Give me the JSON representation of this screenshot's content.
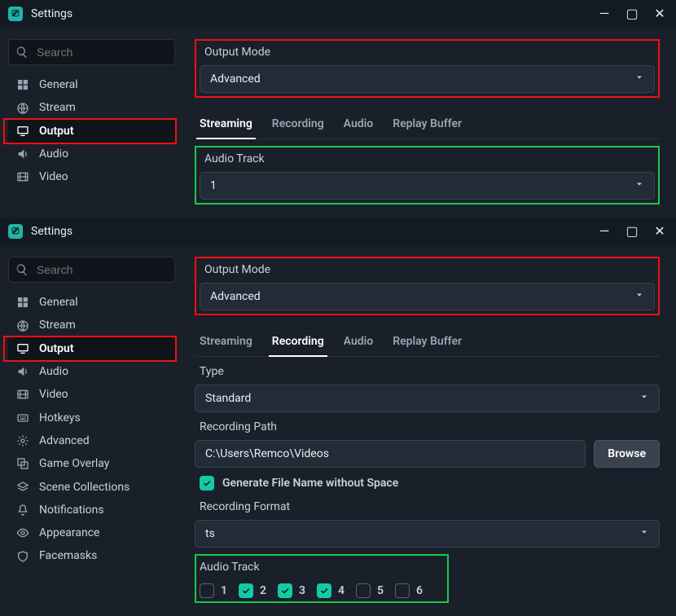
{
  "accent_teal": "#13c9a6",
  "hl_red": "#e11",
  "hl_green": "#19c74e",
  "top": {
    "window_title": "Settings",
    "search_placeholder": "Search",
    "sidebar": [
      {
        "key": "general",
        "label": "General"
      },
      {
        "key": "stream",
        "label": "Stream"
      },
      {
        "key": "output",
        "label": "Output"
      },
      {
        "key": "audio",
        "label": "Audio"
      },
      {
        "key": "video",
        "label": "Video"
      }
    ],
    "output_mode": {
      "label": "Output Mode",
      "value": "Advanced"
    },
    "tabs": [
      {
        "key": "streaming",
        "label": "Streaming"
      },
      {
        "key": "recording",
        "label": "Recording"
      },
      {
        "key": "audio",
        "label": "Audio"
      },
      {
        "key": "replay",
        "label": "Replay Buffer"
      }
    ],
    "active_tab": "streaming",
    "audio_track": {
      "label": "Audio Track",
      "value": "1"
    }
  },
  "bottom": {
    "window_title": "Settings",
    "search_placeholder": "Search",
    "sidebar": [
      {
        "key": "general",
        "label": "General"
      },
      {
        "key": "stream",
        "label": "Stream"
      },
      {
        "key": "output",
        "label": "Output"
      },
      {
        "key": "audio",
        "label": "Audio"
      },
      {
        "key": "video",
        "label": "Video"
      },
      {
        "key": "hotkeys",
        "label": "Hotkeys"
      },
      {
        "key": "advanced",
        "label": "Advanced"
      },
      {
        "key": "game-overlay",
        "label": "Game Overlay"
      },
      {
        "key": "scene-collections",
        "label": "Scene Collections"
      },
      {
        "key": "notifications",
        "label": "Notifications"
      },
      {
        "key": "appearance",
        "label": "Appearance"
      },
      {
        "key": "facemasks",
        "label": "Facemasks"
      }
    ],
    "output_mode": {
      "label": "Output Mode",
      "value": "Advanced"
    },
    "tabs": [
      {
        "key": "streaming",
        "label": "Streaming"
      },
      {
        "key": "recording",
        "label": "Recording"
      },
      {
        "key": "audio",
        "label": "Audio"
      },
      {
        "key": "replay",
        "label": "Replay Buffer"
      }
    ],
    "active_tab": "recording",
    "type": {
      "label": "Type",
      "value": "Standard"
    },
    "recording_path": {
      "label": "Recording Path",
      "value": "C:\\Users\\Remco\\Videos",
      "browse_label": "Browse"
    },
    "gen_filename": {
      "checked": true,
      "label": "Generate File Name without Space"
    },
    "recording_format": {
      "label": "Recording Format",
      "value": "ts"
    },
    "audio_track": {
      "label": "Audio Track",
      "tracks": [
        {
          "n": "1",
          "checked": false
        },
        {
          "n": "2",
          "checked": true
        },
        {
          "n": "3",
          "checked": true
        },
        {
          "n": "4",
          "checked": true
        },
        {
          "n": "5",
          "checked": false
        },
        {
          "n": "6",
          "checked": false
        }
      ]
    }
  }
}
